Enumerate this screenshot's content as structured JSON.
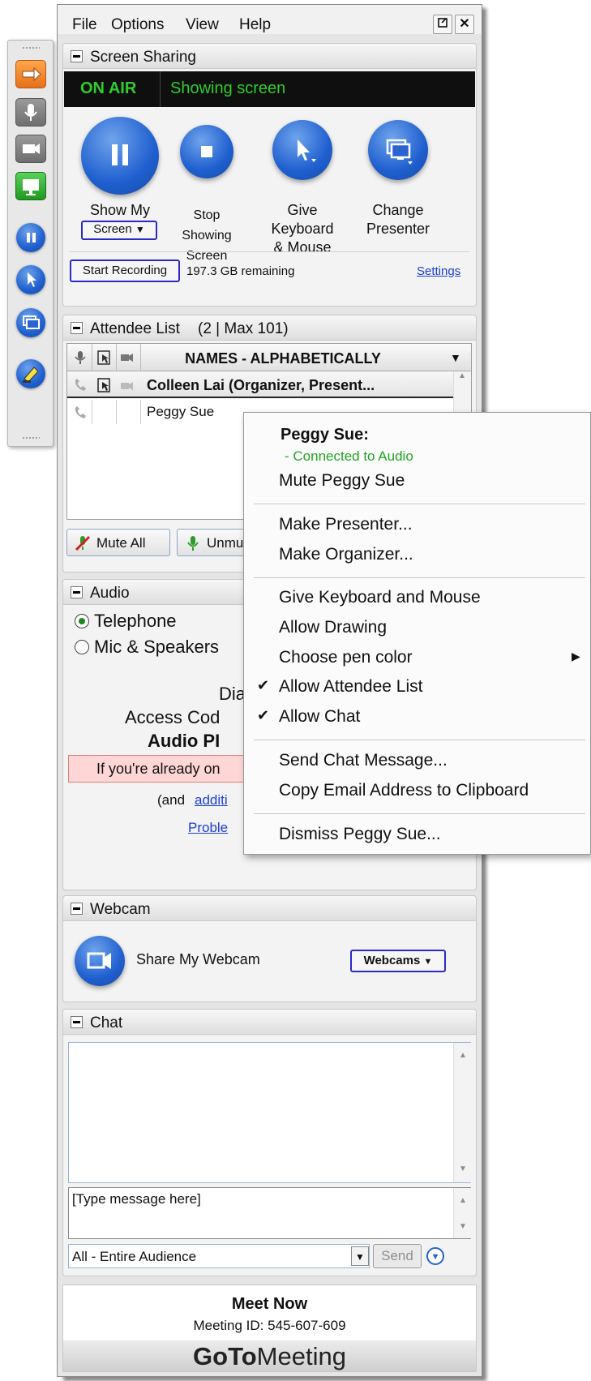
{
  "menu": {
    "file": "File",
    "options": "Options",
    "view": "View",
    "help": "Help"
  },
  "screen_sharing": {
    "title": "Screen Sharing",
    "status": "ON AIR",
    "status_text": "Showing screen",
    "show_my_label": "Show My",
    "show_my_select": "Screen",
    "stop_label_1": "Stop",
    "stop_label_2": "Showing",
    "stop_label_3": "Screen",
    "give_label_1": "Give",
    "give_label_2": "Keyboard",
    "give_label_3": "& Mouse",
    "change_label_1": "Change",
    "change_label_2": "Presenter",
    "start_recording": "Start Recording",
    "remaining": "197.3 GB remaining",
    "settings": "Settings"
  },
  "attendees": {
    "title": "Attendee List",
    "count": "(2 | Max 101)",
    "column_header": "NAMES - ALPHABETICALLY",
    "rows": [
      {
        "name": "Colleen Lai (Organizer, Present..."
      },
      {
        "name": "Peggy Sue"
      }
    ],
    "mute_all": "Mute All",
    "unmute_all": "Unmu"
  },
  "audio": {
    "title": "Audio",
    "telephone": "Telephone",
    "mic": "Mic & Speakers",
    "dial": "Dia",
    "access_code": "Access Cod",
    "audio_pin": "Audio PI",
    "warning": "If you're already on",
    "and": "(and",
    "additional": "additi",
    "problem": "Proble"
  },
  "webcam": {
    "title": "Webcam",
    "share": "Share My Webcam",
    "webcams": "Webcams"
  },
  "chat": {
    "title": "Chat",
    "input_placeholder": "[Type message here]",
    "audience": "All - Entire Audience",
    "send": "Send"
  },
  "footer": {
    "meet_now": "Meet Now",
    "meeting_id": "Meeting ID: 545-607-609",
    "brand_goto": "GoTo",
    "brand_meeting": "Meeting"
  },
  "context_menu": {
    "header": "Peggy Sue:",
    "connected": "- Connected to Audio",
    "mute": "Mute Peggy Sue",
    "make_presenter": "Make Presenter...",
    "make_organizer": "Make Organizer...",
    "give_keyboard": "Give Keyboard and Mouse",
    "allow_drawing": "Allow Drawing",
    "pen_color": "Choose pen color",
    "allow_attendee_list": "Allow Attendee List",
    "allow_chat": "Allow Chat",
    "send_chat": "Send Chat Message...",
    "copy_email": "Copy Email Address to Clipboard",
    "dismiss": "Dismiss Peggy Sue..."
  },
  "colors": {
    "on_air_green": "#2ecc2e",
    "accent_blue": "#1f5fcf",
    "connected_green": "#23a423",
    "warning_bg": "#ffd6d6"
  },
  "icons": [
    "microphone-icon",
    "webcam-icon",
    "screen-icon",
    "pause-icon",
    "pointer-icon",
    "presenter-icon",
    "highlighter-icon",
    "telephone-icon",
    "keyboard-icon",
    "stop-icon",
    "checkmark-icon",
    "submenu-arrow-icon"
  ]
}
